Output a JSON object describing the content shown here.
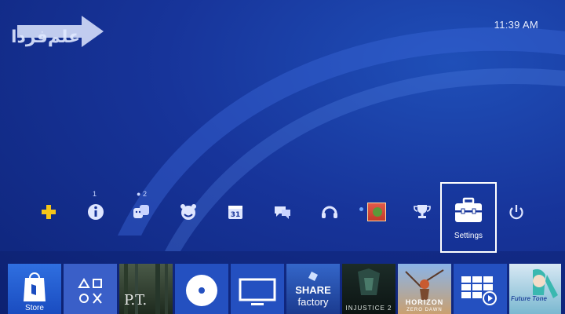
{
  "status": {
    "time": "11:39 AM"
  },
  "watermark": {
    "text": "علم‌فردا"
  },
  "function_bar": {
    "items": [
      {
        "name": "playstation-plus",
        "icon": "plus-icon"
      },
      {
        "name": "whats-new",
        "icon": "info-icon",
        "badge": "1"
      },
      {
        "name": "friends",
        "icon": "friends-icon",
        "badge": "2"
      },
      {
        "name": "party",
        "icon": "party-icon"
      },
      {
        "name": "events",
        "icon": "calendar-icon",
        "label": "31"
      },
      {
        "name": "messages",
        "icon": "messages-icon"
      },
      {
        "name": "communities",
        "icon": "headset-icon"
      },
      {
        "name": "profile",
        "icon": "avatar"
      },
      {
        "name": "trophies",
        "icon": "trophy-icon"
      },
      {
        "name": "settings",
        "icon": "toolbox-icon",
        "label": "Settings",
        "selected": true
      },
      {
        "name": "power",
        "icon": "power-icon"
      }
    ]
  },
  "tiles": {
    "store_label": "Store",
    "share_factory_line1": "SHARE",
    "share_factory_line2": "factory",
    "pt_title": "P.T.",
    "injustice_title": "INJUSTICE 2",
    "horizon_title": "HORIZON",
    "horizon_sub": "ZERO DAWN",
    "miku_title": "Future Tone"
  },
  "colors": {
    "background": "#17349a",
    "plus_yellow": "#f5c518",
    "selected_border": "#ffffff"
  }
}
